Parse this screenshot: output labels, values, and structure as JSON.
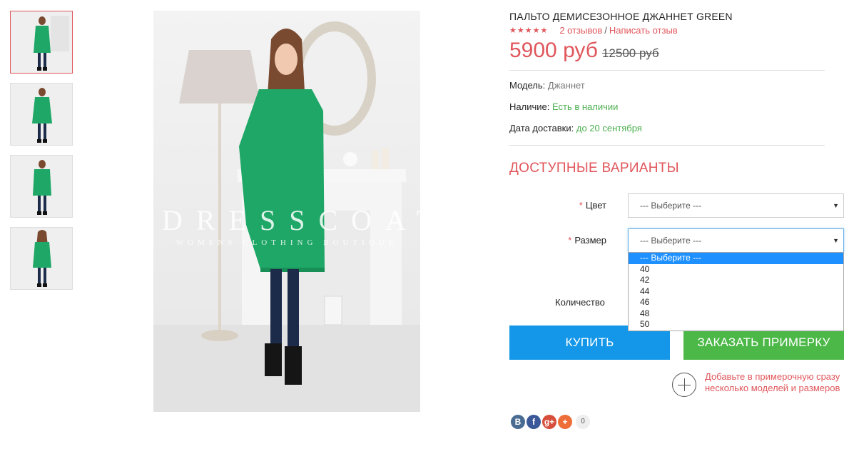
{
  "product": {
    "title": "ПАЛЬТО ДЕМИСЕЗОННОЕ ДЖАННЕТ GREEN",
    "stars": "★★★★★",
    "reviews_link": "2 отзывов",
    "separator": "/",
    "write_review_link": "Написать отзыв",
    "price": "5900 руб",
    "old_price": "12500 руб"
  },
  "gallery": {
    "watermark_brand": "DRESSCOAT",
    "watermark_tagline": "WOMENS CLOTHING BOUTIQUE",
    "thumbnail_count": 4,
    "colors": {
      "coat": "#1ea766",
      "active_border": "#e0565b"
    }
  },
  "meta": {
    "model_label": "Модель:",
    "model_value": "Джаннет",
    "stock_label": "Наличие:",
    "stock_value": "Есть в наличии",
    "delivery_label": "Дата доставки:",
    "delivery_value": "до 20 сентября"
  },
  "variants": {
    "title": "ДОСТУПНЫЕ ВАРИАНТЫ",
    "required_mark": "*",
    "color_label": "Цвет",
    "color_value": "--- Выберите ---",
    "size_label": "Размер",
    "size_value": "--- Выберите ---",
    "size_options": [
      "--- Выберите ---",
      "40",
      "42",
      "44",
      "46",
      "48",
      "50"
    ],
    "size_selected_index": 0,
    "quantity_label": "Количество"
  },
  "actions": {
    "buy_label": "КУПИТЬ",
    "try_on_label": "ЗАКАЗАТЬ ПРИМЕРКУ",
    "promo_text": "Добавьте в примерочную сразу несколько моделей и размеров",
    "buy_color": "#1497e8",
    "try_on_color": "#4cb848"
  },
  "share": {
    "vk": "B",
    "facebook": "f",
    "google_plus": "g+",
    "more": "+",
    "count": "0"
  }
}
